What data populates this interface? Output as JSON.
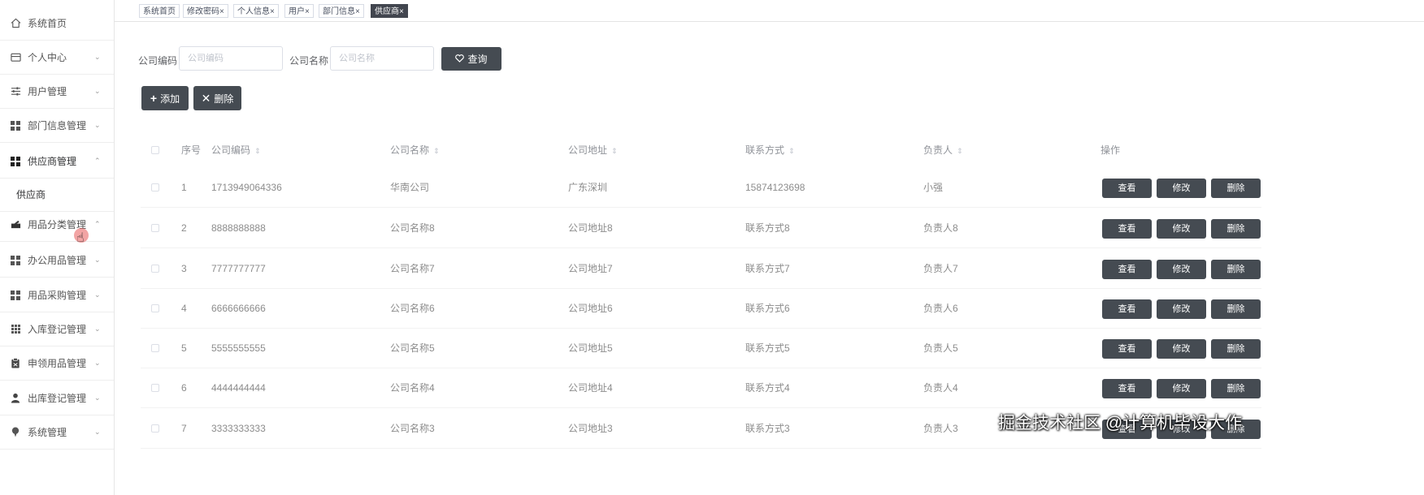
{
  "sidebar": {
    "items": [
      {
        "label": "系统首页",
        "icon": "home-icon",
        "arrow": ""
      },
      {
        "label": "个人中心",
        "icon": "wallet-icon",
        "arrow": "⌄"
      },
      {
        "label": "用户管理",
        "icon": "sliders-icon",
        "arrow": "⌄"
      },
      {
        "label": "部门信息管理",
        "icon": "grid-icon",
        "arrow": "⌄"
      },
      {
        "label": "供应商管理",
        "icon": "grid-icon",
        "arrow": "⌃"
      },
      {
        "label": "用品分类管理",
        "icon": "inbox-icon",
        "arrow": "⌃"
      },
      {
        "label": "办公用品管理",
        "icon": "grid-icon",
        "arrow": "⌄"
      },
      {
        "label": "用品采购管理",
        "icon": "grid-icon",
        "arrow": "⌄"
      },
      {
        "label": "入库登记管理",
        "icon": "grid9-icon",
        "arrow": "⌄"
      },
      {
        "label": "申领用品管理",
        "icon": "clipboard-icon",
        "arrow": "⌄"
      },
      {
        "label": "出库登记管理",
        "icon": "user-icon",
        "arrow": "⌄"
      },
      {
        "label": "系统管理",
        "icon": "pin-icon",
        "arrow": "⌄"
      }
    ],
    "submenu": {
      "label": "供应商"
    }
  },
  "tabs": [
    {
      "label": "系统首页",
      "close": ""
    },
    {
      "label": "修改密码",
      "close": "×"
    },
    {
      "label": "个人信息",
      "close": "×"
    },
    {
      "label": "用户",
      "close": "×"
    },
    {
      "label": "部门信息",
      "close": "×"
    },
    {
      "label": "供应商",
      "close": "×"
    }
  ],
  "search": {
    "code_label": "公司编码",
    "code_placeholder": "公司编码",
    "name_label": "公司名称",
    "name_placeholder": "公司名称",
    "query_button": "查询"
  },
  "actions": {
    "add": "添加",
    "delete": "删除"
  },
  "table": {
    "headers": {
      "index": "序号",
      "code": "公司编码",
      "name": "公司名称",
      "address": "公司地址",
      "contact": "联系方式",
      "manager": "负责人",
      "ops": "操作"
    },
    "row_buttons": {
      "view": "查看",
      "edit": "修改",
      "delete": "删除"
    },
    "rows": [
      {
        "index": "1",
        "code": "1713949064336",
        "name": "华南公司",
        "address": "广东深圳",
        "contact": "15874123698",
        "manager": "小强"
      },
      {
        "index": "2",
        "code": "8888888888",
        "name": "公司名称8",
        "address": "公司地址8",
        "contact": "联系方式8",
        "manager": "负责人8"
      },
      {
        "index": "3",
        "code": "7777777777",
        "name": "公司名称7",
        "address": "公司地址7",
        "contact": "联系方式7",
        "manager": "负责人7"
      },
      {
        "index": "4",
        "code": "6666666666",
        "name": "公司名称6",
        "address": "公司地址6",
        "contact": "联系方式6",
        "manager": "负责人6"
      },
      {
        "index": "5",
        "code": "5555555555",
        "name": "公司名称5",
        "address": "公司地址5",
        "contact": "联系方式5",
        "manager": "负责人5"
      },
      {
        "index": "6",
        "code": "4444444444",
        "name": "公司名称4",
        "address": "公司地址4",
        "contact": "联系方式4",
        "manager": "负责人4"
      },
      {
        "index": "7",
        "code": "3333333333",
        "name": "公司名称3",
        "address": "公司地址3",
        "contact": "联系方式3",
        "manager": "负责人3"
      }
    ]
  },
  "watermark": "掘金技术社区 @计算机毕设大作"
}
